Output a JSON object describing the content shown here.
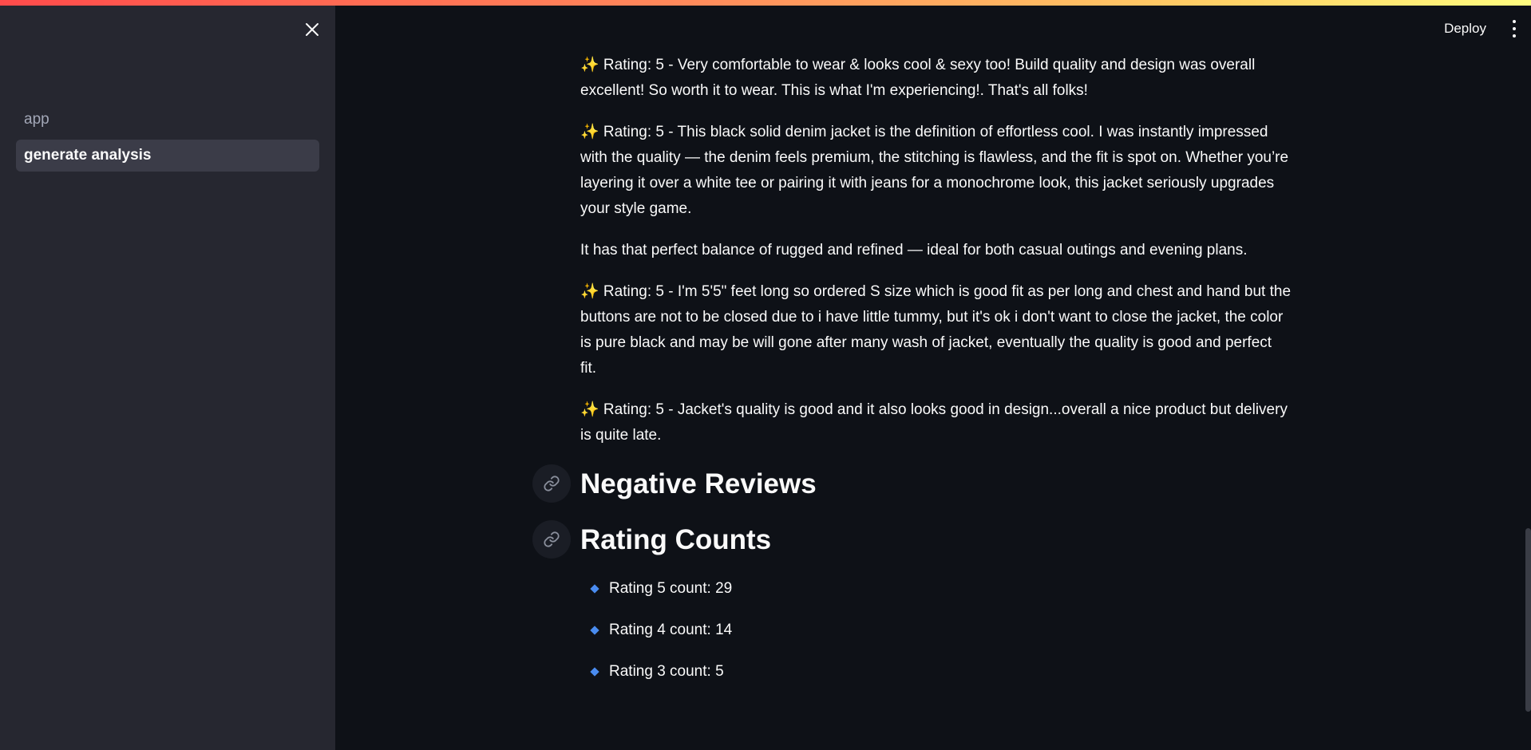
{
  "sidebar": {
    "items": [
      {
        "label": "app",
        "active": false
      },
      {
        "label": "generate analysis",
        "active": true
      }
    ]
  },
  "header": {
    "deploy_label": "Deploy"
  },
  "reviews": {
    "paragraphs": [
      "✨ Rating: 5 - Very comfortable to wear & looks cool & sexy too! Build quality and design was overall excellent! So worth it to wear. This is what I'm experiencing!. That's all folks!",
      "✨ Rating: 5 - This black solid denim jacket is the definition of effortless cool. I was instantly impressed with the quality — the denim feels premium, the stitching is flawless, and the fit is spot on. Whether you’re layering it over a white tee or pairing it with jeans for a monochrome look, this jacket seriously upgrades your style game.",
      "It has that perfect balance of rugged and refined — ideal for both casual outings and evening plans.",
      "✨ Rating: 5 - I'm 5'5\" feet long so ordered S size which is good fit as per long and chest and hand but the buttons are not to be closed due to i have little tummy, but it's ok i don't want to close the jacket, the color is pure black and may be will gone after many wash of jacket, eventually the quality is good and perfect fit.",
      "✨ Rating: 5 - Jacket's quality is good and it also looks good in design...overall a nice product but delivery is quite late."
    ]
  },
  "negative_heading": "Negative Reviews",
  "rating_counts": {
    "heading": "Rating Counts",
    "items": [
      "Rating 5 count: 29",
      "Rating 4 count: 14",
      "Rating 3 count: 5"
    ]
  },
  "colors": {
    "background": "#0e1117",
    "sidebar": "#262730",
    "accent_bullet": "#4a8cf0"
  }
}
